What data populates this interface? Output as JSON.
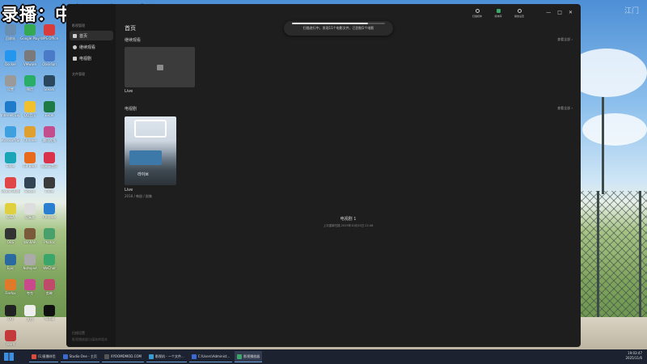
{
  "overlay": {
    "stream_title": "录播：中午1点开播",
    "watermark": "江门"
  },
  "desktop": {
    "icons": [
      {
        "label": "回收站",
        "color": "#6b8fb3"
      },
      {
        "label": "Google Play",
        "color": "#34a853"
      },
      {
        "label": "WPS Office",
        "color": "#d83b3b"
      },
      {
        "label": "Docker",
        "color": "#2496ed"
      },
      {
        "label": "VMware",
        "color": "#7a7a7a"
      },
      {
        "label": "Obsidian",
        "color": "#4b7ac9"
      },
      {
        "label": "设置",
        "color": "#9a9a9a"
      },
      {
        "label": "微信",
        "color": "#2aae67"
      },
      {
        "label": "Steam",
        "color": "#2a475e"
      },
      {
        "label": "Internet Explorer",
        "color": "#1f7ac9"
      },
      {
        "label": "QQ音乐",
        "color": "#f0c02e"
      },
      {
        "label": "Excel",
        "color": "#1d7a45"
      },
      {
        "label": "Microsoft Store",
        "color": "#3fa0e0"
      },
      {
        "label": "Chrome",
        "color": "#e0a030"
      },
      {
        "label": "腾讯视频",
        "color": "#c44d8d"
      },
      {
        "label": "Edge",
        "color": "#1aa6b7"
      },
      {
        "label": "Git Bash",
        "color": "#e86a1c"
      },
      {
        "label": "网易云音乐",
        "color": "#d9324a"
      },
      {
        "label": "Visual Studio",
        "color": "#e04646"
      },
      {
        "label": "Steam",
        "color": "#345"
      },
      {
        "label": "Code",
        "color": "#3b3b3b"
      },
      {
        "label": "IDEA",
        "color": "#e0d040"
      },
      {
        "label": "记事本",
        "color": "#ddd"
      },
      {
        "label": "Chrome",
        "color": "#2b7fd0"
      },
      {
        "label": "OBS",
        "color": "#333"
      },
      {
        "label": "WinRAR",
        "color": "#7a5a3a"
      },
      {
        "label": "Photos",
        "color": "#4aa06a"
      },
      {
        "label": "Epic",
        "color": "#2a6aa0"
      },
      {
        "label": "Notepad",
        "color": "#aaa"
      },
      {
        "label": "WeChat",
        "color": "#3aa66a"
      },
      {
        "label": "Firefox",
        "color": "#e07a2a"
      },
      {
        "label": "夸克",
        "color": "#c84a8a"
      },
      {
        "label": "剪映",
        "color": "#c04a6a"
      },
      {
        "label": "QQ",
        "color": "#222"
      },
      {
        "label": "文档",
        "color": "#eee"
      },
      {
        "label": "TikTok",
        "color": "#111"
      },
      {
        "label": "Word",
        "color": "#c43a3a"
      }
    ]
  },
  "app": {
    "sidebar": {
      "heading": "影视管理",
      "items": [
        {
          "label": "首页",
          "active": true
        },
        {
          "label": "继续观看",
          "active": false
        },
        {
          "label": "电视剧",
          "active": false
        }
      ],
      "section": "文件管理",
      "footer_line1": "扫描设置",
      "footer_line2": "影视播放器与媒体库版本"
    },
    "page_title": "首页",
    "toast": {
      "text": "扫描进行中，发现11个电影文件，已刮削1个电影",
      "progress": 0.82
    },
    "toolbar": [
      {
        "label": "扫描媒体",
        "icon": "scan-icon"
      },
      {
        "label": "媒体库",
        "icon": "library-icon"
      },
      {
        "label": "播放设置",
        "icon": "settings-icon"
      }
    ],
    "window_controls": {
      "minimize": "—",
      "maximize": "□",
      "close": "✕"
    },
    "sections": {
      "recent": {
        "title": "继续观看",
        "see_all": "查看全部 ›",
        "card_label": "Live"
      },
      "tv": {
        "title": "电视剧",
        "see_all": "查看全部 ›",
        "card_label": "Live",
        "card_meta": "2018 / 韩剧 / 剧集",
        "poster_text": "라이브"
      }
    },
    "summary": {
      "line1": "电视剧 1",
      "line2": "上次重新扫描 2025年10月15日 22:46"
    }
  },
  "taskbar": {
    "items": [
      {
        "label": "(1)直播伴侣",
        "color": "#e04a3a",
        "active": false
      },
      {
        "label": "Studio One - 主页",
        "color": "#3a6ad0",
        "active": false
      },
      {
        "label": "XYOOMDMOD.COM",
        "color": "#555",
        "active": false
      },
      {
        "label": "影视机 - 一个文件...",
        "color": "#3a9ad0",
        "active": false
      },
      {
        "label": "C:\\Users\\Administ...",
        "color": "#3a6ad0",
        "active": false
      },
      {
        "label": "影视播放器",
        "color": "#3aa66a",
        "active": true
      }
    ],
    "time": "19:03:47",
    "date": "2025/11/6"
  }
}
